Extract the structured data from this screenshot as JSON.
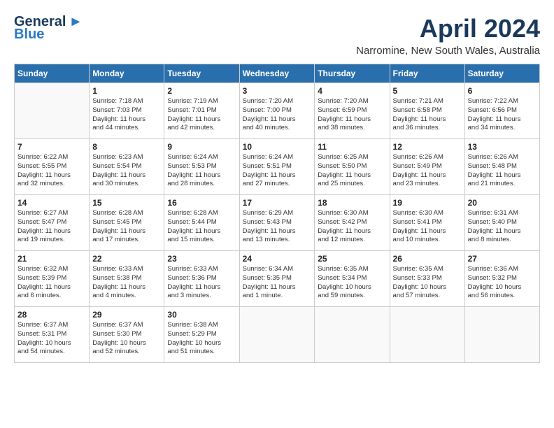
{
  "logo": {
    "line1": "General",
    "line2": "Blue"
  },
  "title": "April 2024",
  "subtitle": "Narromine, New South Wales, Australia",
  "days_header": [
    "Sunday",
    "Monday",
    "Tuesday",
    "Wednesday",
    "Thursday",
    "Friday",
    "Saturday"
  ],
  "weeks": [
    [
      {
        "day": "",
        "info": ""
      },
      {
        "day": "1",
        "info": "Sunrise: 7:18 AM\nSunset: 7:03 PM\nDaylight: 11 hours\nand 44 minutes."
      },
      {
        "day": "2",
        "info": "Sunrise: 7:19 AM\nSunset: 7:01 PM\nDaylight: 11 hours\nand 42 minutes."
      },
      {
        "day": "3",
        "info": "Sunrise: 7:20 AM\nSunset: 7:00 PM\nDaylight: 11 hours\nand 40 minutes."
      },
      {
        "day": "4",
        "info": "Sunrise: 7:20 AM\nSunset: 6:59 PM\nDaylight: 11 hours\nand 38 minutes."
      },
      {
        "day": "5",
        "info": "Sunrise: 7:21 AM\nSunset: 6:58 PM\nDaylight: 11 hours\nand 36 minutes."
      },
      {
        "day": "6",
        "info": "Sunrise: 7:22 AM\nSunset: 6:56 PM\nDaylight: 11 hours\nand 34 minutes."
      }
    ],
    [
      {
        "day": "7",
        "info": "Sunrise: 6:22 AM\nSunset: 5:55 PM\nDaylight: 11 hours\nand 32 minutes."
      },
      {
        "day": "8",
        "info": "Sunrise: 6:23 AM\nSunset: 5:54 PM\nDaylight: 11 hours\nand 30 minutes."
      },
      {
        "day": "9",
        "info": "Sunrise: 6:24 AM\nSunset: 5:53 PM\nDaylight: 11 hours\nand 28 minutes."
      },
      {
        "day": "10",
        "info": "Sunrise: 6:24 AM\nSunset: 5:51 PM\nDaylight: 11 hours\nand 27 minutes."
      },
      {
        "day": "11",
        "info": "Sunrise: 6:25 AM\nSunset: 5:50 PM\nDaylight: 11 hours\nand 25 minutes."
      },
      {
        "day": "12",
        "info": "Sunrise: 6:26 AM\nSunset: 5:49 PM\nDaylight: 11 hours\nand 23 minutes."
      },
      {
        "day": "13",
        "info": "Sunrise: 6:26 AM\nSunset: 5:48 PM\nDaylight: 11 hours\nand 21 minutes."
      }
    ],
    [
      {
        "day": "14",
        "info": "Sunrise: 6:27 AM\nSunset: 5:47 PM\nDaylight: 11 hours\nand 19 minutes."
      },
      {
        "day": "15",
        "info": "Sunrise: 6:28 AM\nSunset: 5:45 PM\nDaylight: 11 hours\nand 17 minutes."
      },
      {
        "day": "16",
        "info": "Sunrise: 6:28 AM\nSunset: 5:44 PM\nDaylight: 11 hours\nand 15 minutes."
      },
      {
        "day": "17",
        "info": "Sunrise: 6:29 AM\nSunset: 5:43 PM\nDaylight: 11 hours\nand 13 minutes."
      },
      {
        "day": "18",
        "info": "Sunrise: 6:30 AM\nSunset: 5:42 PM\nDaylight: 11 hours\nand 12 minutes."
      },
      {
        "day": "19",
        "info": "Sunrise: 6:30 AM\nSunset: 5:41 PM\nDaylight: 11 hours\nand 10 minutes."
      },
      {
        "day": "20",
        "info": "Sunrise: 6:31 AM\nSunset: 5:40 PM\nDaylight: 11 hours\nand 8 minutes."
      }
    ],
    [
      {
        "day": "21",
        "info": "Sunrise: 6:32 AM\nSunset: 5:39 PM\nDaylight: 11 hours\nand 6 minutes."
      },
      {
        "day": "22",
        "info": "Sunrise: 6:33 AM\nSunset: 5:38 PM\nDaylight: 11 hours\nand 4 minutes."
      },
      {
        "day": "23",
        "info": "Sunrise: 6:33 AM\nSunset: 5:36 PM\nDaylight: 11 hours\nand 3 minutes."
      },
      {
        "day": "24",
        "info": "Sunrise: 6:34 AM\nSunset: 5:35 PM\nDaylight: 11 hours\nand 1 minute."
      },
      {
        "day": "25",
        "info": "Sunrise: 6:35 AM\nSunset: 5:34 PM\nDaylight: 10 hours\nand 59 minutes."
      },
      {
        "day": "26",
        "info": "Sunrise: 6:35 AM\nSunset: 5:33 PM\nDaylight: 10 hours\nand 57 minutes."
      },
      {
        "day": "27",
        "info": "Sunrise: 6:36 AM\nSunset: 5:32 PM\nDaylight: 10 hours\nand 56 minutes."
      }
    ],
    [
      {
        "day": "28",
        "info": "Sunrise: 6:37 AM\nSunset: 5:31 PM\nDaylight: 10 hours\nand 54 minutes."
      },
      {
        "day": "29",
        "info": "Sunrise: 6:37 AM\nSunset: 5:30 PM\nDaylight: 10 hours\nand 52 minutes."
      },
      {
        "day": "30",
        "info": "Sunrise: 6:38 AM\nSunset: 5:29 PM\nDaylight: 10 hours\nand 51 minutes."
      },
      {
        "day": "",
        "info": ""
      },
      {
        "day": "",
        "info": ""
      },
      {
        "day": "",
        "info": ""
      },
      {
        "day": "",
        "info": ""
      }
    ]
  ]
}
